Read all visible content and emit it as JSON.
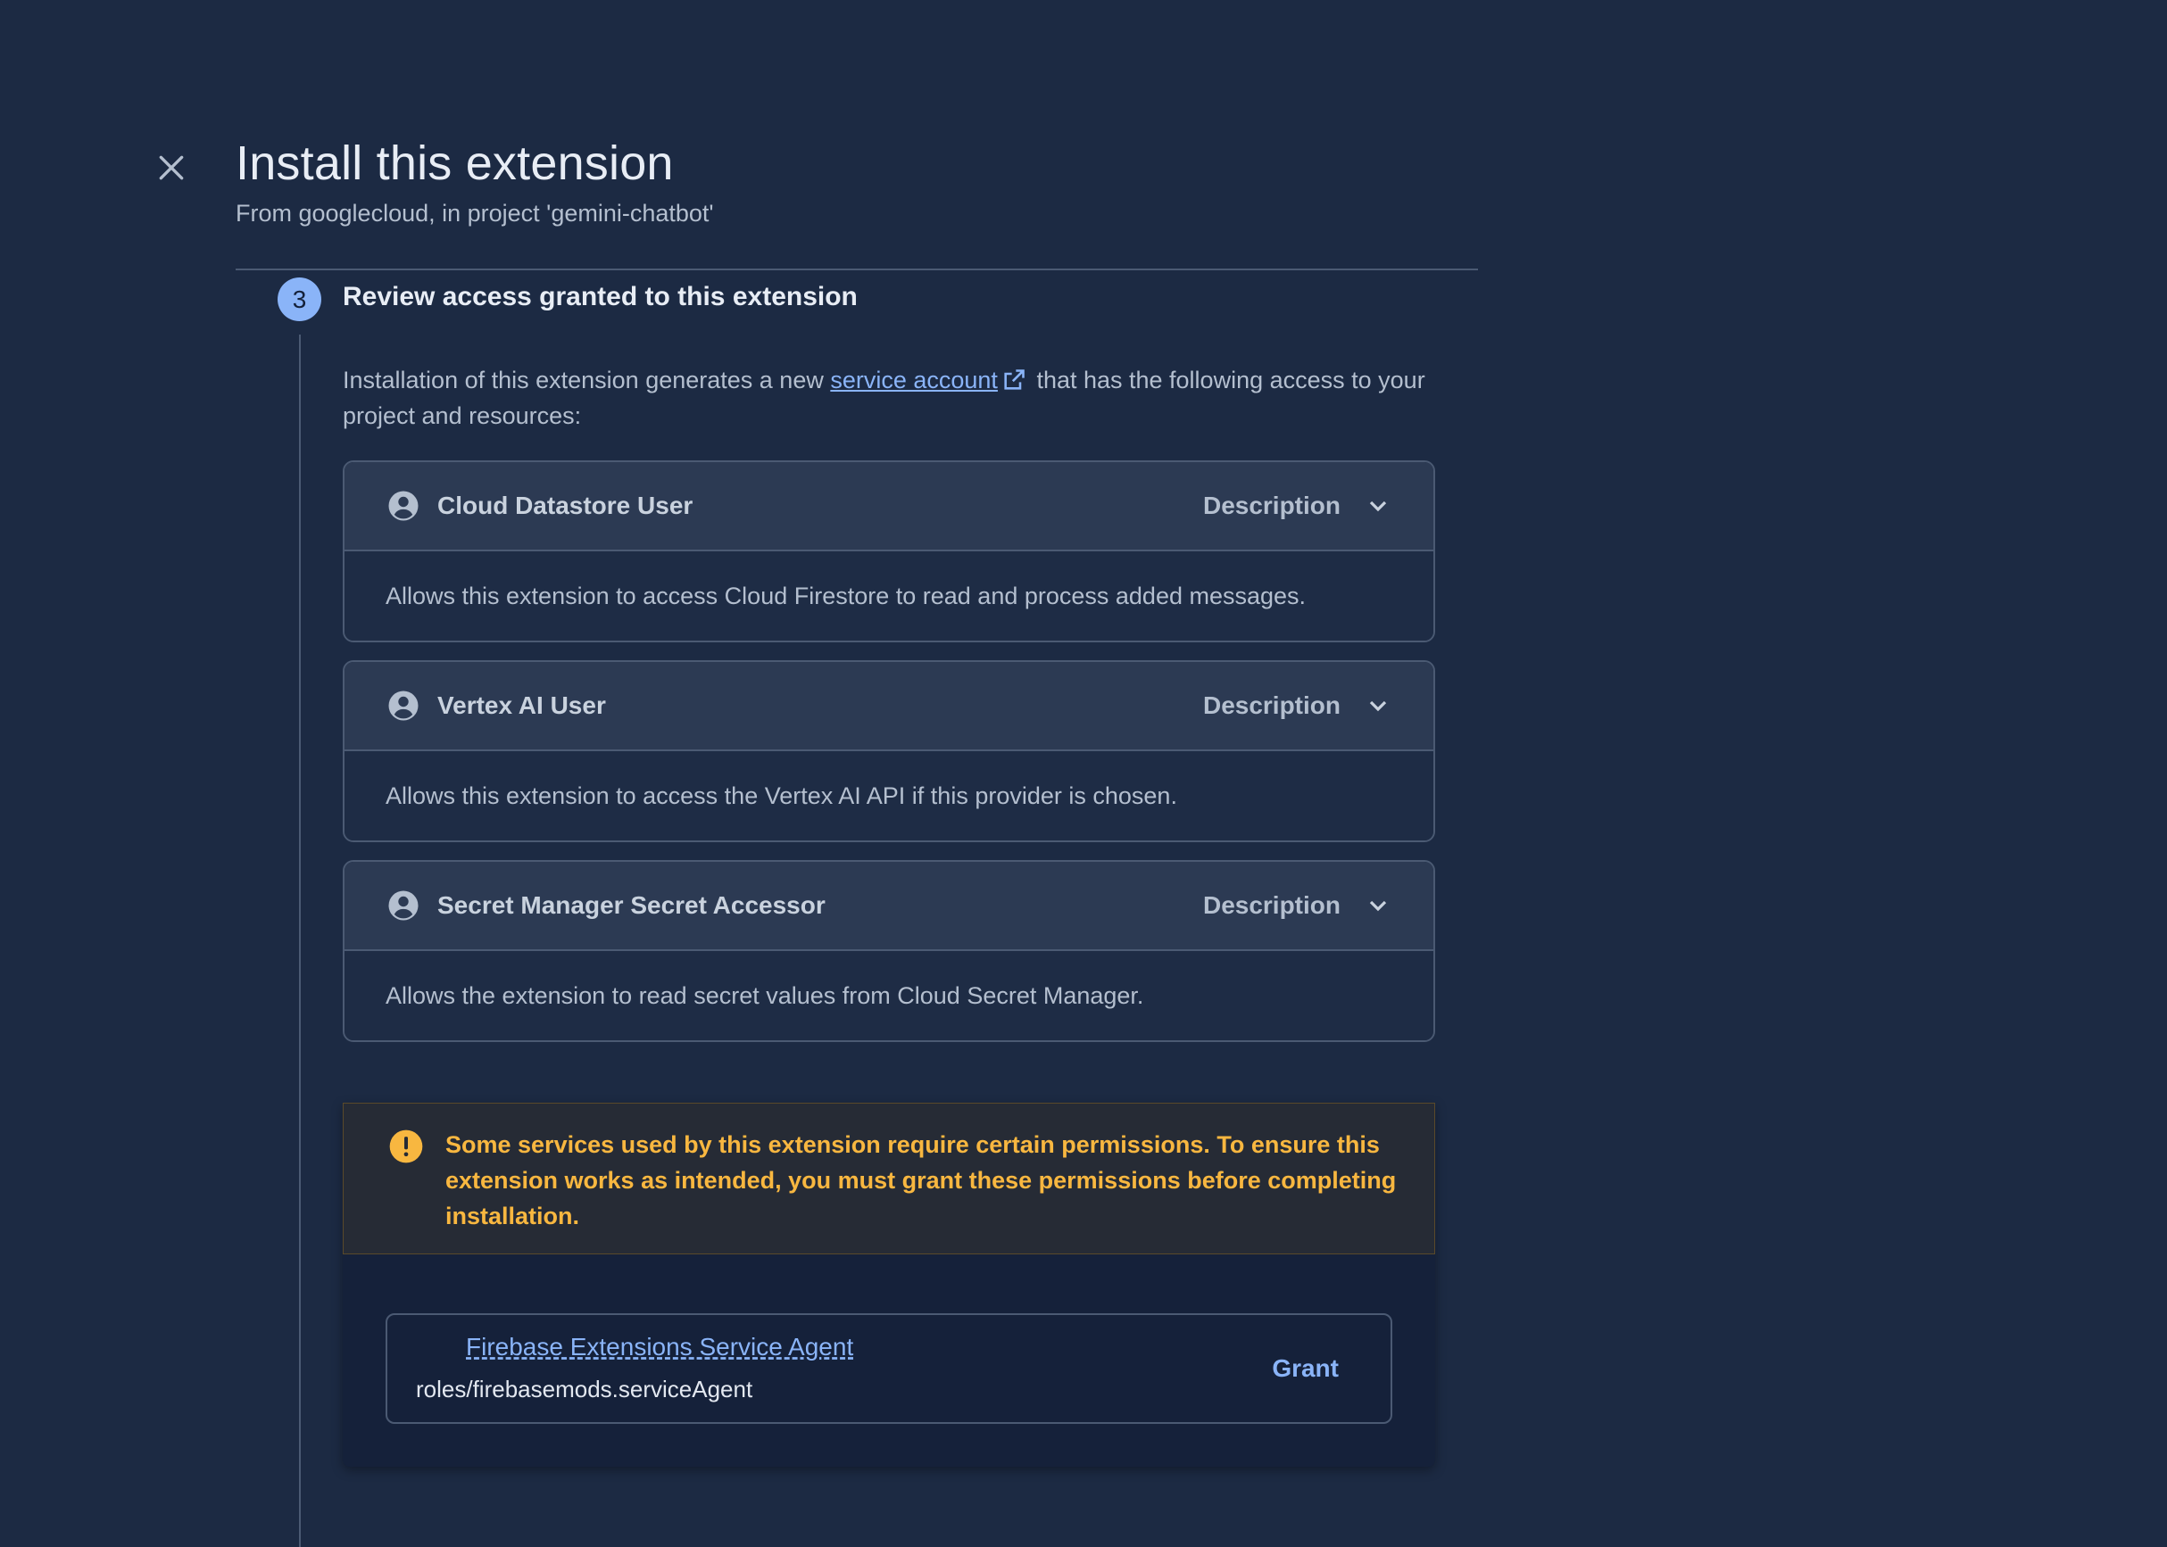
{
  "header": {
    "title": "Install this extension",
    "subtitle": "From googlecloud, in project 'gemini-chatbot'"
  },
  "step": {
    "number": "3",
    "title": "Review access granted to this extension"
  },
  "intro": {
    "prefix": "Installation of this extension generates a new ",
    "link": "service account",
    "suffix": " that has the following access to your project and resources:"
  },
  "roles": [
    {
      "name": "Cloud Datastore User",
      "toggle_label": "Description",
      "description": "Allows this extension to access Cloud Firestore to read and process added messages."
    },
    {
      "name": "Vertex AI User",
      "toggle_label": "Description",
      "description": "Allows this extension to access the Vertex AI API if this provider is chosen."
    },
    {
      "name": "Secret Manager Secret Accessor",
      "toggle_label": "Description",
      "description": "Allows the extension to read secret values from Cloud Secret Manager."
    }
  ],
  "warning": {
    "text": "Some services used by this extension require certain permissions. To ensure this extension works as intended, you must grant these permissions before completing installation."
  },
  "grant": {
    "link": "Firebase Extensions Service Agent",
    "role": "roles/firebasemods.serviceAgent",
    "button_label": "Grant"
  },
  "colors": {
    "background": "#1c2a43",
    "accent": "#8ab4f8",
    "warning": "#f8b740"
  }
}
